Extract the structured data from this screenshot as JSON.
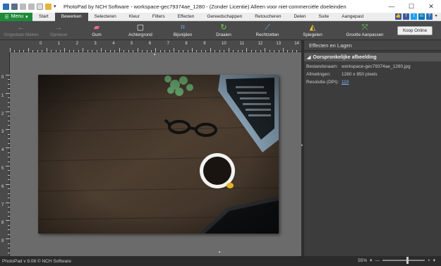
{
  "window": {
    "title": "PhotoPad by NCH Software - workspace-gec79374ae_1280 - (Zonder Licentie) Alleen voor niet-commerciële doeleinden",
    "controls": [
      "—",
      "☐",
      "✕"
    ]
  },
  "menu": {
    "menu_button": "Menu",
    "tabs": [
      "Start",
      "Bewerken",
      "Selecteren",
      "Kleur",
      "Filters",
      "Effecten",
      "Gereedschappen",
      "Retoucheren",
      "Delen",
      "Suite",
      "Aangepast"
    ],
    "active_tab": "Bewerken"
  },
  "toolbar": {
    "buttons": [
      {
        "label": "Ongedaan Maken",
        "icon": "undo-icon",
        "glyph": "←",
        "enabled": false
      },
      {
        "label": "Opnieuw",
        "icon": "redo-icon",
        "glyph": "→",
        "enabled": false
      },
      {
        "label": "Gum",
        "icon": "eraser-icon",
        "glyph": "▰",
        "enabled": true
      },
      {
        "label": "Achtergrond",
        "icon": "background-icon",
        "glyph": "▢",
        "enabled": true
      },
      {
        "label": "Bijsnijden",
        "icon": "crop-icon",
        "glyph": "⌗",
        "enabled": true
      },
      {
        "label": "Draaien",
        "icon": "rotate-icon",
        "glyph": "↻",
        "enabled": true
      },
      {
        "label": "Rechtzetten",
        "icon": "straighten-icon",
        "glyph": "⟋",
        "enabled": true
      },
      {
        "label": "Spiegelen",
        "icon": "flip-icon",
        "glyph": "◭",
        "enabled": true
      },
      {
        "label": "Grootte Aanpassen",
        "icon": "resize-icon",
        "glyph": "⤧",
        "enabled": true
      }
    ],
    "buy_online": "Koop Online"
  },
  "ruler": {
    "labels": [
      "0",
      "1",
      "2",
      "3",
      "4",
      "5",
      "6",
      "7",
      "8",
      "9",
      "10",
      "11",
      "12",
      "13",
      "14"
    ],
    "v_labels": [
      "0",
      "1",
      "2",
      "3",
      "4",
      "5",
      "6",
      "7",
      "8",
      "9"
    ]
  },
  "panel": {
    "title": "Effecten en Lagen",
    "section": "Oorspronkelijke afbeelding",
    "rows": [
      {
        "key": "Bestandsnaam:",
        "value": "workspace-gec79374ae_1280.jpg",
        "link": false
      },
      {
        "key": "Afmetingen:",
        "value": "1280 x 850 pixels",
        "link": false
      },
      {
        "key": "Resolutie (DPI):",
        "value": "110",
        "link": true
      }
    ]
  },
  "status": {
    "version": "PhotoPad v 9.08 © NCH Software",
    "zoom": "55%",
    "zoom_level": 0.6
  },
  "colors": {
    "menu_green": "#1f8a3a",
    "toolbar": "#4a4a4a",
    "canvas": "#6b6b6b",
    "link": "#7fb6ff"
  }
}
